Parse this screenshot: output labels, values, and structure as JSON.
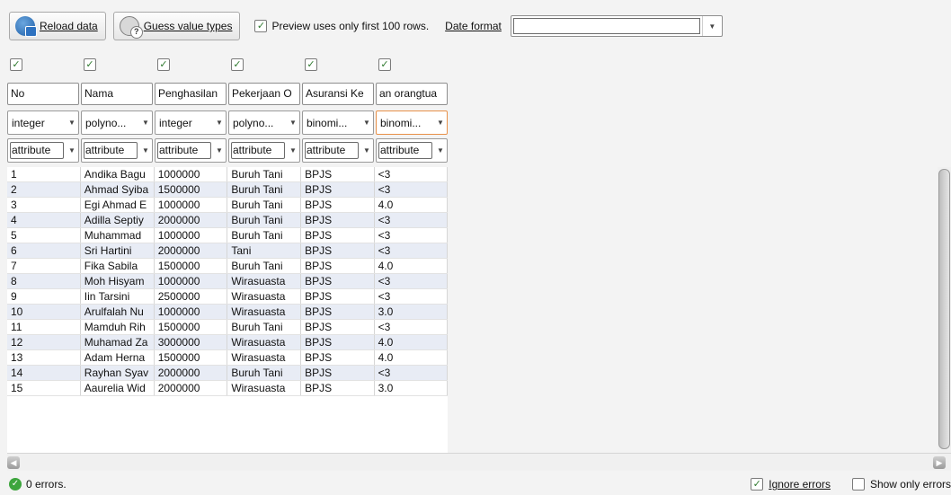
{
  "toolbar": {
    "reload_label": "Reload data",
    "guess_label": "Guess value types",
    "preview_label": "Preview uses only first 100 rows.",
    "preview_checked": true,
    "date_format_label": "Date format",
    "date_format_value": ""
  },
  "columns": [
    {
      "name": "No",
      "type": "integer",
      "role": "attribute",
      "selected": true
    },
    {
      "name": "Nama",
      "type": "polyno...",
      "role": "attribute",
      "selected": true
    },
    {
      "name": "Penghasilan",
      "type": "integer",
      "role": "attribute",
      "selected": true
    },
    {
      "name": "Pekerjaan O",
      "type": "polyno...",
      "role": "attribute",
      "selected": true
    },
    {
      "name": "Asuransi Ke",
      "type": "binomi...",
      "role": "attribute",
      "selected": true
    },
    {
      "name": "an orangtua",
      "type": "binomi...",
      "role": "attribute",
      "selected": true
    }
  ],
  "rows": [
    [
      "1",
      "Andika Bagu",
      "1000000",
      "Buruh Tani",
      "BPJS",
      "<3"
    ],
    [
      "2",
      "Ahmad Syiba",
      "1500000",
      "Buruh Tani",
      "BPJS",
      "<3"
    ],
    [
      "3",
      "Egi Ahmad E",
      "1000000",
      "Buruh Tani",
      "BPJS",
      "4.0"
    ],
    [
      "4",
      "Adilla Septiy",
      "2000000",
      "Buruh Tani",
      "BPJS",
      "<3"
    ],
    [
      "5",
      "Muhammad",
      "1000000",
      "Buruh Tani",
      "BPJS",
      "<3"
    ],
    [
      "6",
      "Sri Hartini",
      "2000000",
      "Tani",
      "BPJS",
      "<3"
    ],
    [
      "7",
      "Fika Sabila",
      "1500000",
      "Buruh Tani",
      "BPJS",
      "4.0"
    ],
    [
      "8",
      "Moh Hisyam",
      "1000000",
      "Wirasuasta",
      "BPJS",
      "<3"
    ],
    [
      "9",
      "Iin Tarsini",
      "2500000",
      "Wirasuasta",
      "BPJS",
      "<3"
    ],
    [
      "10",
      "Arulfalah Nu",
      "1000000",
      "Wirasuasta",
      "BPJS",
      "3.0"
    ],
    [
      "11",
      "Mamduh Rih",
      "1500000",
      "Buruh Tani",
      "BPJS",
      "<3"
    ],
    [
      "12",
      "Muhamad Za",
      "3000000",
      "Wirasuasta",
      "BPJS",
      "4.0"
    ],
    [
      "13",
      "Adam Herna",
      "1500000",
      "Wirasuasta",
      "BPJS",
      "4.0"
    ],
    [
      "14",
      "Rayhan Syav",
      "2000000",
      "Buruh Tani",
      "BPJS",
      "<3"
    ],
    [
      "15",
      "Aaurelia Wid",
      "2000000",
      "Wirasuasta",
      "BPJS",
      "3.0"
    ]
  ],
  "status": {
    "errors_text": "0 errors.",
    "ignore_errors_label": "Ignore errors",
    "ignore_errors_checked": true,
    "show_only_errors_label": "Show only errors",
    "show_only_errors_checked": false
  },
  "colors": {
    "row_alt": "#e8ecf5",
    "focus_border": "#e8914a",
    "ok_green": "#3da53d"
  }
}
